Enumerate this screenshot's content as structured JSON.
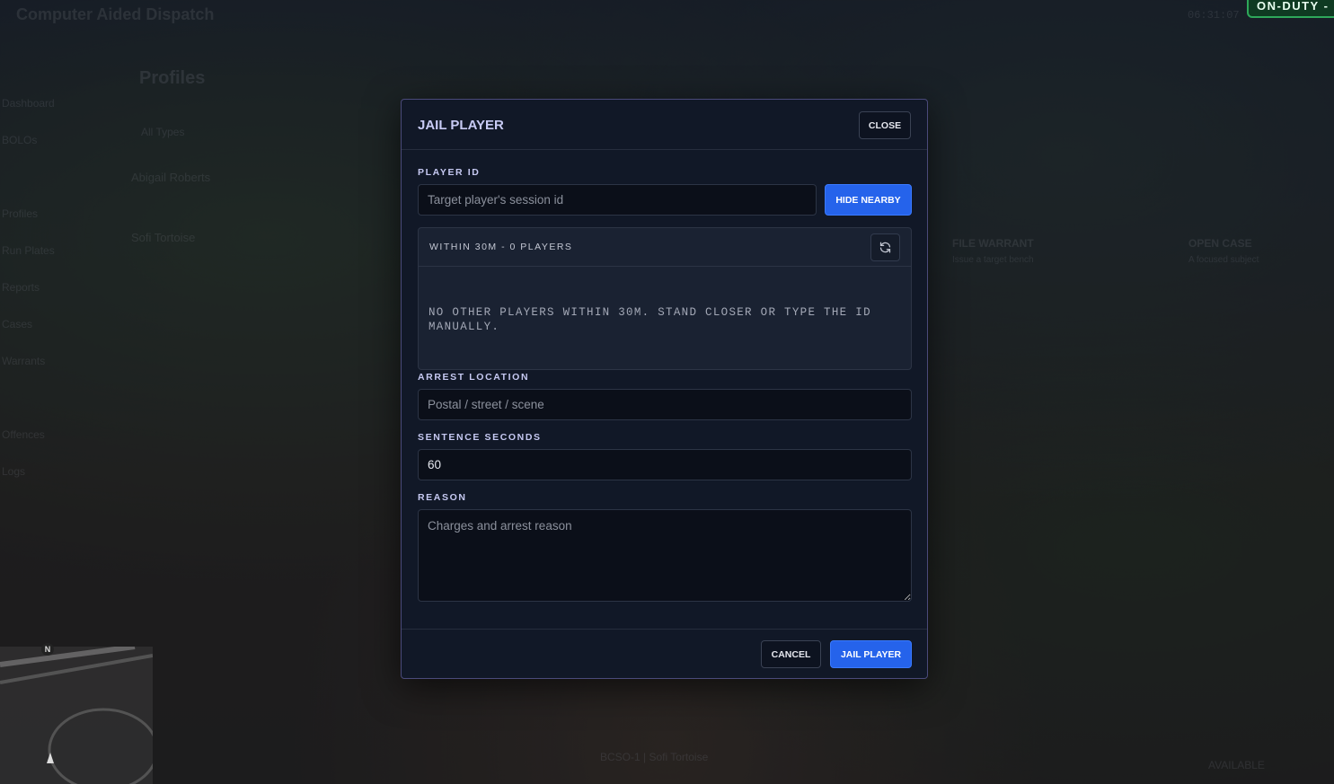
{
  "background": {
    "app_title": "Computer Aided Dispatch",
    "clock": "06:31:07",
    "nav_items": [
      "Dashboard",
      "BOLOs",
      "",
      "Profiles",
      "Run Plates",
      "Reports",
      "Cases",
      "Warrants",
      "",
      "Offences",
      "Logs"
    ],
    "page_title": "Profiles",
    "filter_label": "All Types",
    "profiles": [
      "Abigail Roberts",
      "Sofi Tortoise"
    ],
    "actions": [
      {
        "label": "FILE WARRANT",
        "sub": "Issue a target bench"
      },
      {
        "label": "OPEN CASE",
        "sub": "A focused subject"
      }
    ],
    "footer_unit": "BCSO-1 | Sofi Tortoise",
    "status": "AVAILABLE"
  },
  "status_badge": "ON-DUTY -",
  "minimap": {
    "north": "N"
  },
  "modal": {
    "title": "JAIL PLAYER",
    "close_label": "CLOSE",
    "player_id": {
      "label": "PLAYER ID",
      "placeholder": "Target player's session id",
      "value": ""
    },
    "hide_nearby_label": "HIDE NEARBY",
    "nearby": {
      "header": "WITHIN 30M - 0 PLAYERS",
      "refresh_icon": "refresh-icon",
      "empty_message": "NO OTHER PLAYERS WITHIN 30M. STAND CLOSER OR TYPE THE ID MANUALLY."
    },
    "arrest_location": {
      "label": "ARREST LOCATION",
      "placeholder": "Postal / street / scene",
      "value": ""
    },
    "sentence_seconds": {
      "label": "SENTENCE SECONDS",
      "value": "60"
    },
    "reason": {
      "label": "REASON",
      "placeholder": "Charges and arrest reason",
      "value": ""
    },
    "cancel_label": "CANCEL",
    "submit_label": "JAIL PLAYER"
  },
  "colors": {
    "accent_blue": "#2563eb",
    "label_lavender": "#c6c9f2",
    "modal_bg": "#111827",
    "onduty_green": "#2ea85a"
  }
}
